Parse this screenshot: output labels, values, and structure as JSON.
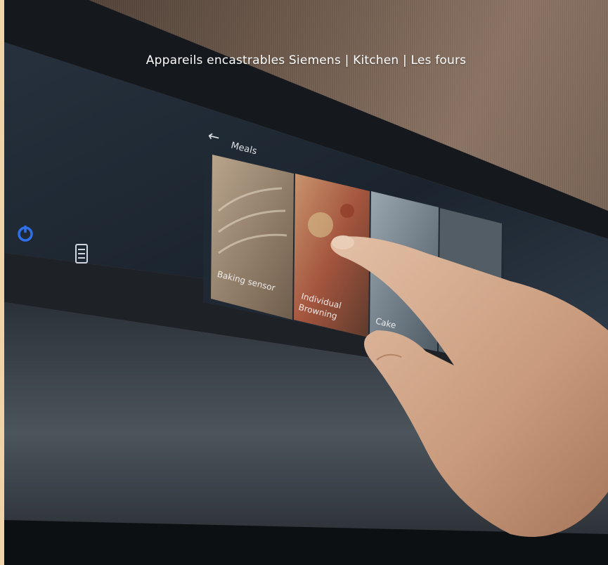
{
  "caption": "Appareils encastrables Siemens | Kitchen | Les fours",
  "display": {
    "back_arrow": "←",
    "section_title": "Meals",
    "tiles": [
      {
        "label": "Baking sensor"
      },
      {
        "label": "Individual\nBrowning"
      },
      {
        "label": "Cake"
      }
    ]
  },
  "icons": [
    "power-icon",
    "menu-list-icon",
    "back-arrow-icon"
  ],
  "colors": {
    "page_background": "#f2d3a8",
    "power_icon": "#2f6fe8",
    "display_glass": "#1c2631"
  }
}
